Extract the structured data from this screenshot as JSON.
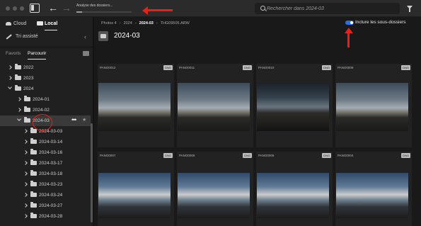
{
  "toolbar": {
    "status_text": "Analyse des dossiers...",
    "progress": 0.1,
    "search_placeholder": "Rechercher dans 2024-03"
  },
  "sidebar": {
    "source_tabs": [
      "Cloud",
      "Local"
    ],
    "active_source": "Local",
    "assisted_sort": "Tri assisté",
    "sub_tabs": [
      "Favoris",
      "Parcourir"
    ],
    "active_sub_tab": "Parcourir",
    "tree": [
      {
        "label": "2022",
        "level": 1,
        "expanded": false
      },
      {
        "label": "2023",
        "level": 1,
        "expanded": false
      },
      {
        "label": "2024",
        "level": 1,
        "expanded": true
      },
      {
        "label": "2024-01",
        "level": 2,
        "expanded": false
      },
      {
        "label": "2024-02",
        "level": 2,
        "expanded": false
      },
      {
        "label": "2024-03",
        "level": 2,
        "expanded": true,
        "selected": true
      },
      {
        "label": "2024-03-03",
        "level": 3,
        "expanded": false
      },
      {
        "label": "2024-03-14",
        "level": 3,
        "expanded": false
      },
      {
        "label": "2024-03-16",
        "level": 3,
        "expanded": false
      },
      {
        "label": "2024-03-17",
        "level": 3,
        "expanded": false
      },
      {
        "label": "2024-03-18",
        "level": 3,
        "expanded": false
      },
      {
        "label": "2024-03-23",
        "level": 3,
        "expanded": false
      },
      {
        "label": "2024-03-24",
        "level": 3,
        "expanded": false
      },
      {
        "label": "2024-03-27",
        "level": 3,
        "expanded": false
      },
      {
        "label": "2024-03-28",
        "level": 3,
        "expanded": false
      }
    ],
    "more_label": "•••"
  },
  "main": {
    "breadcrumb": [
      "Photos 4",
      "2024",
      "2024-03",
      "THG09505.ARW"
    ],
    "breadcrumb_current_index": 2,
    "include_subfolders_label": "Inclure les sous-dossiers",
    "include_subfolders": true,
    "folder_title": "2024-03",
    "photos_row1": [
      {
        "name": "PANO0012",
        "format": "DNG",
        "tone": "light"
      },
      {
        "name": "PANO0011",
        "format": "DNG",
        "tone": "light"
      },
      {
        "name": "PANO0010",
        "format": "DNG",
        "tone": "dark"
      },
      {
        "name": "PANO0009",
        "format": "DNG",
        "tone": "light"
      }
    ],
    "photos_row2": [
      {
        "name": "PANO0007",
        "format": "DNG"
      },
      {
        "name": "PANO0006",
        "format": "DNG"
      },
      {
        "name": "PANO0005",
        "format": "DNG"
      },
      {
        "name": "PANO0004",
        "format": "DNG"
      }
    ]
  },
  "colors": {
    "accent_toggle": "#2e6fe0",
    "annotation_red": "#e2231a"
  }
}
